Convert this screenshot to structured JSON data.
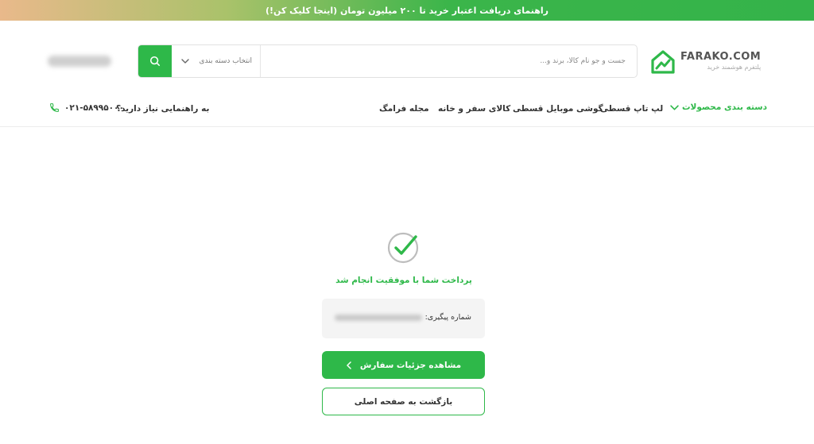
{
  "banner": {
    "text": "راهنمای دریافت اعتبار خرید تا ۲۰۰ میلیون تومان (اینجا کلیک کن!)"
  },
  "logo": {
    "name": "FARAKO.COM",
    "tagline": "پلتفرم هوشمند خرید"
  },
  "search": {
    "placeholder": "جست و جو نام کالا، برند و...",
    "category_label": "انتخاب دسته بندی"
  },
  "nav": {
    "categories": "دسته بندی محصولات",
    "items": [
      "لپ تاپ قسطی",
      "گوشی موبایل قسطی",
      "کالای سفر و خانه",
      "مجله فرامگ"
    ],
    "help_text": "به راهنمایی نیاز دارید؟",
    "phone": "۰۲۱-۵۸۹۹۵۰۰۰"
  },
  "result": {
    "message": "پرداخت شما با موفقیت انجام شد",
    "tracking_label": "شماره پیگیری:",
    "details_button": "مشاهده جزئیات سفارش",
    "home_button": "بازگشت به صفحه اصلی"
  },
  "icons": [
    "search-icon",
    "chevron-down-icon",
    "phone-icon",
    "check-circle-icon",
    "chevron-left-icon",
    "logo-mark-icon"
  ],
  "colors": {
    "accent": "#2eb849"
  }
}
